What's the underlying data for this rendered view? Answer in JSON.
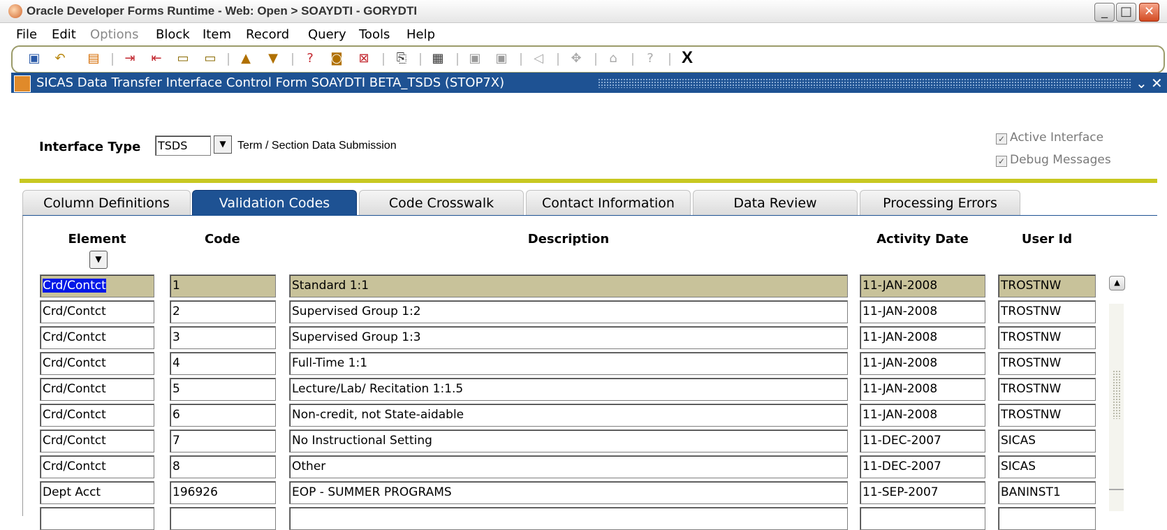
{
  "window": {
    "title": "Oracle Developer Forms Runtime - Web:  Open > SOAYDTI - GORYDTI",
    "controls": [
      "_",
      "□",
      "✕"
    ]
  },
  "menu": [
    {
      "label": "File",
      "disabled": false
    },
    {
      "label": "Edit",
      "disabled": false
    },
    {
      "label": "Options",
      "disabled": true
    },
    {
      "label": "Block",
      "disabled": false
    },
    {
      "label": "Item",
      "disabled": false
    },
    {
      "label": "Record",
      "disabled": false
    },
    {
      "label": "Query",
      "disabled": false
    },
    {
      "label": "Tools",
      "disabled": false
    },
    {
      "label": "Help",
      "disabled": false
    }
  ],
  "toolbar": {
    "icons": [
      "save-icon",
      "rollback-icon",
      "print-icon",
      "insert-record-icon",
      "remove-record-icon",
      "lock-record-icon",
      "clear-record-icon",
      "previous-block-icon",
      "next-block-icon",
      "enter-query-icon",
      "execute-query-icon",
      "cancel-query-icon",
      "copy-icon",
      "paste-icon",
      "duplicate-item-icon",
      "duplicate-record-icon",
      "sound-icon",
      "navigate-icon",
      "options-icon",
      "help-icon"
    ],
    "exit_label": "X"
  },
  "form": {
    "title": "SICAS Data Transfer Interface Control Form  SOAYDTI  BETA_TSDS  (STOP7X)",
    "interface_type_label": "Interface Type",
    "interface_type_value": "TSDS",
    "interface_type_desc": "Term / Section Data Submission",
    "active_interface_label": "Active Interface",
    "debug_messages_label": "Debug Messages"
  },
  "tabs": [
    {
      "label": "Column Definitions",
      "active": false
    },
    {
      "label": "Validation Codes",
      "active": true
    },
    {
      "label": "Code Crosswalk",
      "active": false
    },
    {
      "label": "Contact Information",
      "active": false
    },
    {
      "label": "Data Review",
      "active": false
    },
    {
      "label": "Processing Errors",
      "active": false
    }
  ],
  "grid": {
    "headers": {
      "element": "Element",
      "code": "Code",
      "description": "Description",
      "activity_date": "Activity Date",
      "user_id": "User Id"
    },
    "rows": [
      {
        "element": "Crd/Contct",
        "code": "1",
        "description": "Standard 1:1",
        "activity_date": "11-JAN-2008",
        "user_id": "TROSTNW"
      },
      {
        "element": "Crd/Contct",
        "code": "2",
        "description": "Supervised Group 1:2",
        "activity_date": "11-JAN-2008",
        "user_id": "TROSTNW"
      },
      {
        "element": "Crd/Contct",
        "code": "3",
        "description": "Supervised Group 1:3",
        "activity_date": "11-JAN-2008",
        "user_id": "TROSTNW"
      },
      {
        "element": "Crd/Contct",
        "code": "4",
        "description": "Full-Time 1:1",
        "activity_date": "11-JAN-2008",
        "user_id": "TROSTNW"
      },
      {
        "element": "Crd/Contct",
        "code": "5",
        "description": "Lecture/Lab/ Recitation 1:1.5",
        "activity_date": "11-JAN-2008",
        "user_id": "TROSTNW"
      },
      {
        "element": "Crd/Contct",
        "code": "6",
        "description": "Non-credit, not State-aidable",
        "activity_date": "11-JAN-2008",
        "user_id": "TROSTNW"
      },
      {
        "element": "Crd/Contct",
        "code": "7",
        "description": "No Instructional Setting",
        "activity_date": "11-DEC-2007",
        "user_id": "SICAS"
      },
      {
        "element": "Crd/Contct",
        "code": "8",
        "description": "Other",
        "activity_date": "11-DEC-2007",
        "user_id": "SICAS"
      },
      {
        "element": "Dept Acct",
        "code": "196926",
        "description": "EOP - SUMMER PROGRAMS",
        "activity_date": "11-SEP-2007",
        "user_id": "BANINST1"
      },
      {
        "element": "",
        "code": "",
        "description": "",
        "activity_date": "",
        "user_id": ""
      }
    ]
  },
  "colors": {
    "form_title_bg": "#1e5293",
    "selected_row_bg": "#c8c29a",
    "selected_text_bg": "#0018e7",
    "separator_yellow": "#c8c821"
  }
}
